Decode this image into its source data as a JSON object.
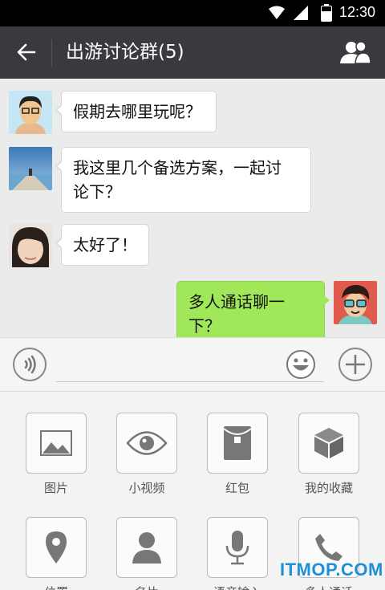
{
  "status_bar": {
    "time": "12:30"
  },
  "header": {
    "title": "出游讨论群(5)"
  },
  "messages": [
    {
      "text": "假期去哪里玩呢？"
    },
    {
      "text_line1": "我这里几个备选方案，一起讨",
      "text_line2": "论下？"
    },
    {
      "text": "太好了！"
    },
    {
      "text": "多人通话聊一下？"
    }
  ],
  "input": {
    "value": ""
  },
  "panel": {
    "items": [
      {
        "label": "图片",
        "icon": "image-icon"
      },
      {
        "label": "小视频",
        "icon": "eye-icon"
      },
      {
        "label": "红包",
        "icon": "red-packet-icon"
      },
      {
        "label": "我的收藏",
        "icon": "cube-icon"
      },
      {
        "label": "位置",
        "icon": "location-pin-icon"
      },
      {
        "label": "名片",
        "icon": "person-icon"
      },
      {
        "label": "语音输入",
        "icon": "microphone-icon"
      },
      {
        "label": "多人通话",
        "icon": "phone-icon"
      }
    ]
  },
  "watermark": "ITMOP.COM",
  "colors": {
    "header_bg": "#393a3f",
    "sent_bubble": "#a0e75a",
    "chat_bg": "#ebebeb"
  }
}
